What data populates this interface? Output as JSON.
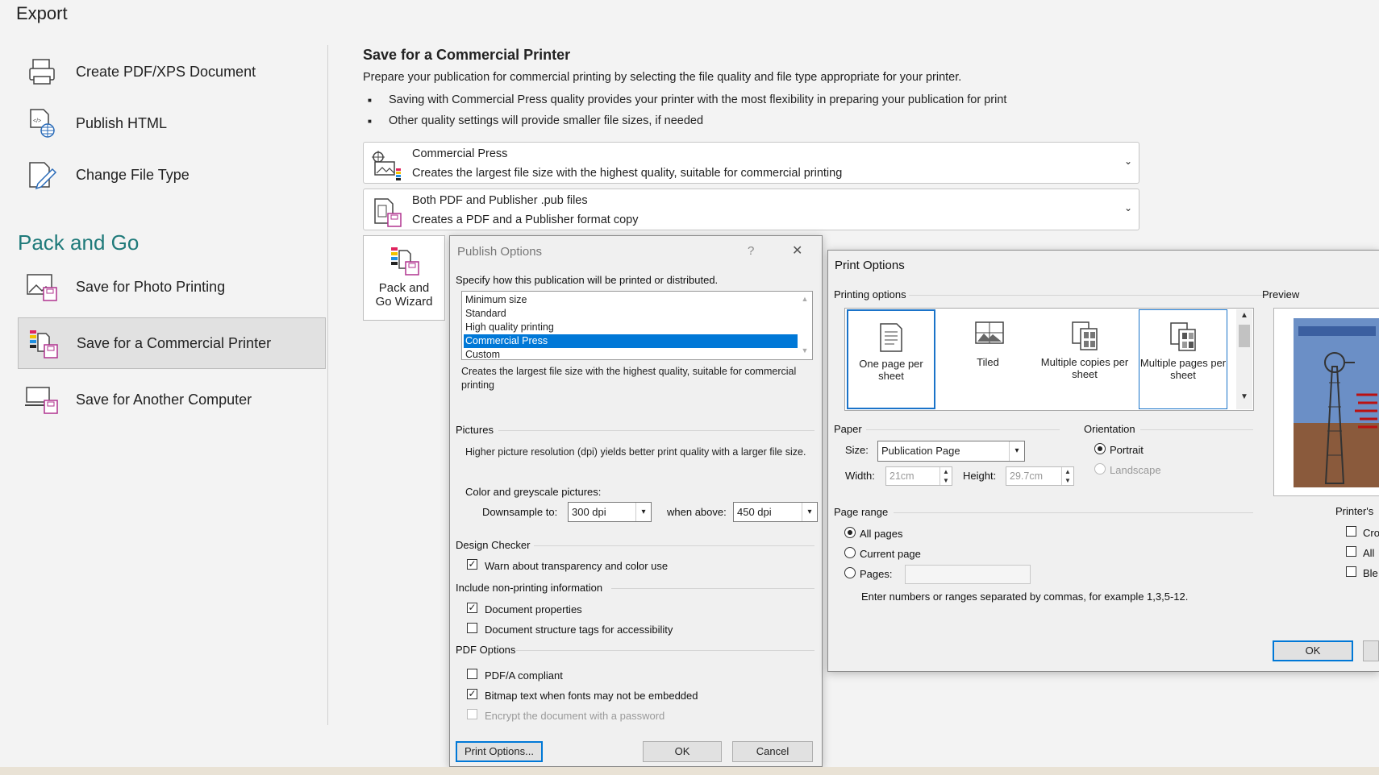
{
  "export_title": "Export",
  "nav": {
    "items": [
      {
        "label": "Create PDF/XPS Document",
        "icon": "printer-icon"
      },
      {
        "label": "Publish HTML",
        "icon": "html-globe-icon"
      },
      {
        "label": "Change File Type",
        "icon": "edit-file-icon"
      }
    ],
    "section_title": "Pack and Go",
    "pack_items": [
      {
        "label": "Save for Photo Printing",
        "icon": "photo-save-icon"
      },
      {
        "label": "Save for a Commercial Printer",
        "icon": "commercial-printer-icon",
        "selected": true
      },
      {
        "label": "Save for Another Computer",
        "icon": "computer-save-icon"
      }
    ]
  },
  "content": {
    "title": "Save for a Commercial Printer",
    "description": "Prepare your publication for commercial printing by selecting the file quality and file type appropriate for your printer.",
    "bullets": [
      "Saving with Commercial Press quality provides your printer with the most flexibility in preparing your publication for print",
      "Other quality settings will provide smaller file sizes, if needed"
    ],
    "quality_dropdown": {
      "title": "Commercial Press",
      "subtitle": "Creates the largest file size with the highest quality, suitable for commercial printing"
    },
    "filetype_dropdown": {
      "title": "Both PDF and Publisher .pub files",
      "subtitle": "Creates a PDF and a Publisher format copy"
    },
    "wizard_label_1": "Pack and",
    "wizard_label_2": "Go Wizard"
  },
  "publish_dialog": {
    "title": "Publish Options",
    "help": "?",
    "close": "✕",
    "specify_label": "Specify how this publication will be printed or distributed.",
    "list_items": [
      "Minimum size",
      "Standard",
      "High quality printing",
      "Commercial Press",
      "Custom"
    ],
    "selected_index": 3,
    "selected_desc": "Creates the largest file size with the highest quality, suitable for commercial printing",
    "pictures_label": "Pictures",
    "pictures_desc": "Higher picture resolution (dpi) yields better print quality with a larger file size.",
    "color_label": "Color and greyscale pictures:",
    "downsample_label": "Downsample to:",
    "downsample_value": "300 dpi",
    "when_above_label": "when above:",
    "when_above_value": "450 dpi",
    "design_checker_label": "Design Checker",
    "warn_transparency": "Warn about transparency and color use",
    "nonprinting_label": "Include non-printing information",
    "doc_properties": "Document properties",
    "doc_structure_tags": "Document structure tags for accessibility",
    "pdf_options_label": "PDF Options",
    "pdfa": "PDF/A compliant",
    "bitmap_text": "Bitmap text when fonts may not be embedded",
    "encrypt": "Encrypt the document with a password",
    "print_options_btn": "Print Options...",
    "ok_btn": "OK",
    "cancel_btn": "Cancel"
  },
  "print_dialog": {
    "title": "Print Options",
    "printing_options_label": "Printing options",
    "tiles": [
      "One page per sheet",
      "Tiled",
      "Multiple copies per sheet",
      "Multiple pages per sheet"
    ],
    "preview_label": "Preview",
    "paper_label": "Paper",
    "size_label": "Size:",
    "size_value": "Publication Page",
    "width_label": "Width:",
    "width_value": "21cm",
    "height_label": "Height:",
    "height_value": "29.7cm",
    "orientation_label": "Orientation",
    "portrait": "Portrait",
    "landscape": "Landscape",
    "page_range_label": "Page range",
    "all_pages": "All pages",
    "current_page": "Current page",
    "pages": "Pages:",
    "range_hint": "Enter numbers or ranges separated by commas, for example 1,3,5-12.",
    "printers_label": "Printer's",
    "printer_checks": [
      "Cro",
      "All",
      "Ble"
    ],
    "ok_btn": "OK"
  }
}
